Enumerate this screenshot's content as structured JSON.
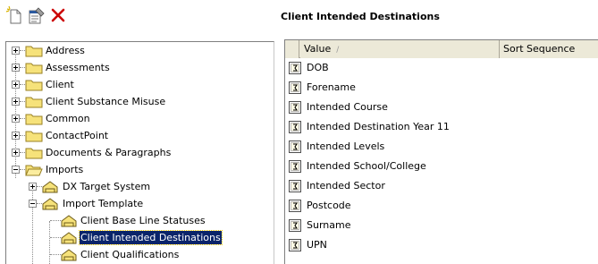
{
  "toolbar": {
    "buttons": [
      {
        "name": "new-item-button",
        "icon": "new-document-icon"
      },
      {
        "name": "properties-button",
        "icon": "properties-icon"
      },
      {
        "name": "delete-button",
        "icon": "red-x-icon",
        "color": "#cc0000"
      }
    ]
  },
  "tree": {
    "items": [
      {
        "label": "Address",
        "level": 0,
        "expanded": false
      },
      {
        "label": "Assessments",
        "level": 0,
        "expanded": false
      },
      {
        "label": "Client",
        "level": 0,
        "expanded": false
      },
      {
        "label": "Client Substance Misuse",
        "level": 0,
        "expanded": false
      },
      {
        "label": "Common",
        "level": 0,
        "expanded": false
      },
      {
        "label": "ContactPoint",
        "level": 0,
        "expanded": false
      },
      {
        "label": "Documents & Paragraphs",
        "level": 0,
        "expanded": false
      },
      {
        "label": "Imports",
        "level": 0,
        "expanded": true
      },
      {
        "label": "DX Target System",
        "level": 1,
        "expanded": false
      },
      {
        "label": "Import Template",
        "level": 1,
        "expanded": true
      },
      {
        "label": "Client Base Line Statuses",
        "level": 2
      },
      {
        "label": "Client Intended Destinations",
        "level": 2,
        "selected": true
      },
      {
        "label": "Client Qualifications",
        "level": 2
      }
    ]
  },
  "right": {
    "title": "Client Intended Destinations",
    "columns": [
      {
        "label": "Value",
        "sort_glyph": "/"
      },
      {
        "label": "Sort Sequence"
      }
    ],
    "rows": [
      "DOB",
      "Forename",
      "Intended Course",
      "Intended Destination Year 11",
      "Intended Levels",
      "Intended School/College",
      "Intended Sector",
      "Postcode",
      "Surname",
      "UPN"
    ]
  },
  "colors": {
    "selection_bg": "#0a246a",
    "selection_fg": "#ffffff",
    "folder_fill": "#f6e27a",
    "header_bg": "#ece9d8"
  }
}
